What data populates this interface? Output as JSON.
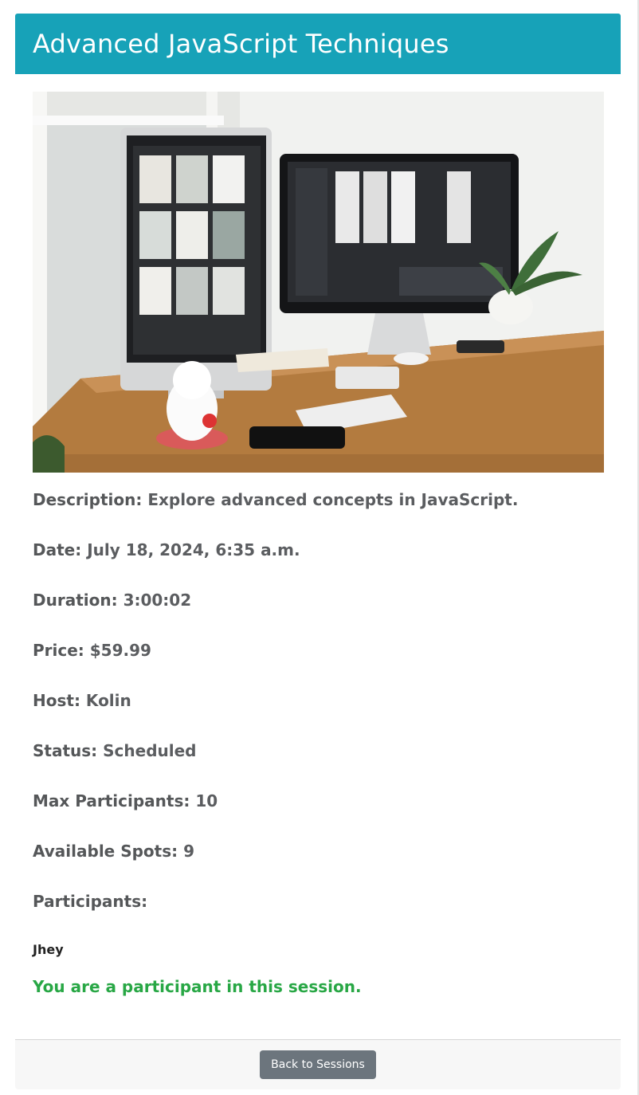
{
  "session": {
    "title": "Advanced JavaScript Techniques",
    "fields": [
      {
        "label": "Description:",
        "value": "Explore advanced concepts in JavaScript."
      },
      {
        "label": "Date:",
        "value": "July 18, 2024, 6:35 a.m."
      },
      {
        "label": "Duration:",
        "value": "3:00:02"
      },
      {
        "label": "Price:",
        "value": "$59.99"
      },
      {
        "label": "Host:",
        "value": "Kolin"
      },
      {
        "label": "Status:",
        "value": "Scheduled"
      },
      {
        "label": "Max Participants:",
        "value": "10"
      },
      {
        "label": "Available Spots:",
        "value": "9"
      },
      {
        "label": "Participants:",
        "value": ""
      }
    ],
    "participants": [
      "Jhey"
    ],
    "participant_notice": "You are a participant in this session."
  },
  "footer": {
    "back_label": "Back to Sessions"
  },
  "colors": {
    "header": "#17a2b8",
    "success": "#28a745",
    "button": "#6c757d"
  }
}
